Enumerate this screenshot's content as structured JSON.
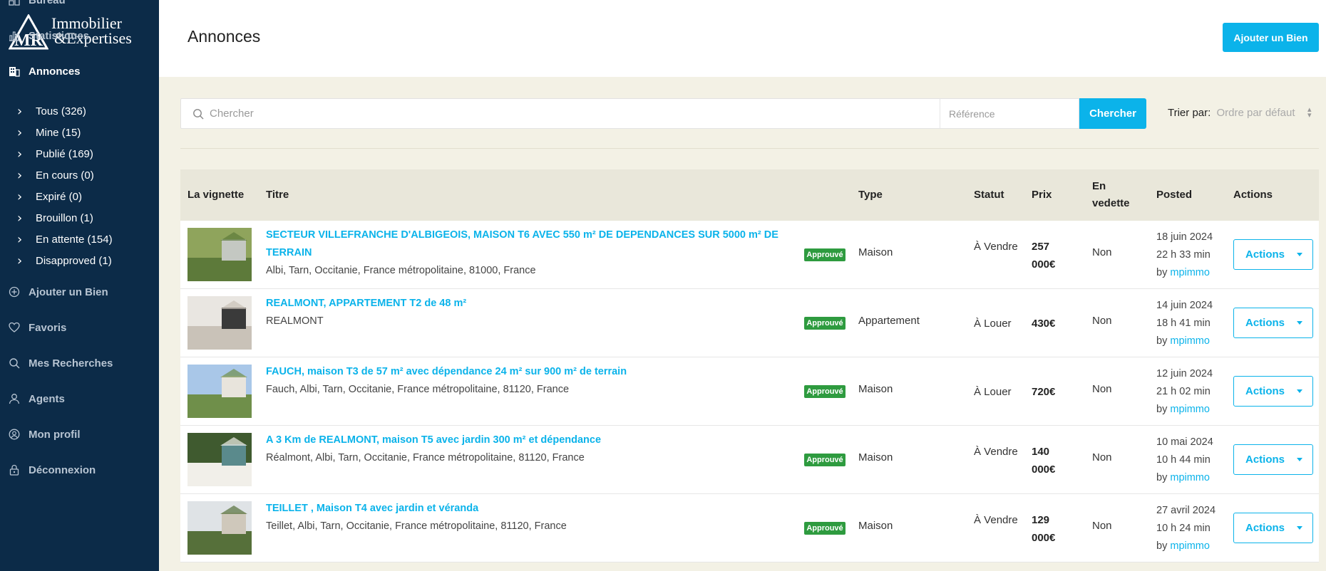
{
  "brand": {
    "logo_monogram": "MR",
    "logo_line1": "Immobilier",
    "logo_line2": "Expertises",
    "sidebar_bg": "#0c2b48",
    "accent": "#0bb3ea"
  },
  "sidebar": {
    "items": [
      {
        "label": "Bureau",
        "icon": "dashboard-icon",
        "active": false
      },
      {
        "label": "Statistiques",
        "icon": "bar-chart-icon",
        "active": false
      },
      {
        "label": "Annonces",
        "icon": "building-icon",
        "active": true
      },
      {
        "label": "Ajouter un Bien",
        "icon": "plus-circle-icon",
        "active": false
      },
      {
        "label": "Favoris",
        "icon": "heart-icon",
        "active": false
      },
      {
        "label": "Mes Recherches",
        "icon": "search-icon",
        "active": false
      },
      {
        "label": "Agents",
        "icon": "user-icon",
        "active": false
      },
      {
        "label": "Mon profil",
        "icon": "user-circle-icon",
        "active": false
      },
      {
        "label": "Déconnexion",
        "icon": "lock-icon",
        "active": false
      }
    ],
    "sub_items": [
      {
        "label": "Tous (326)"
      },
      {
        "label": "Mine (15)"
      },
      {
        "label": "Publié (169)"
      },
      {
        "label": "En cours (0)"
      },
      {
        "label": "Expiré (0)"
      },
      {
        "label": "Brouillon (1)"
      },
      {
        "label": "En attente (154)"
      },
      {
        "label": "Disapproved (1)"
      }
    ]
  },
  "header": {
    "title": "Annonces",
    "add_button": "Ajouter un Bien"
  },
  "search": {
    "placeholder": "Chercher",
    "reference_placeholder": "Référence",
    "button": "Chercher",
    "sort_label": "Trier par:",
    "sort_value": "Ordre par défaut"
  },
  "table": {
    "columns": {
      "thumbnail": "La vignette",
      "title": "Titre",
      "type": "Type",
      "status": "Statut",
      "price": "Prix",
      "featured_l1": "En",
      "featured_l2": "vedette",
      "posted": "Posted",
      "actions": "Actions"
    },
    "rows": [
      {
        "title": "SECTEUR VILLEFRANCHE D'ALBIGEOIS, MAISON T6 AVEC 550 m² DE DEPENDANCES SUR 5000 m² DE TERRAIN",
        "address": "Albi, Tarn, Occitanie, France métropolitaine, 81000, France",
        "badge": "Approuvé",
        "type": "Maison",
        "status": "À Vendre",
        "price": "257 000€",
        "featured": "Non",
        "date": "18 juin 2024",
        "time": "22 h 33 min",
        "by": "by",
        "author": "mpimmo",
        "actions": "Actions",
        "thumb_colors": [
          "#8fa45c",
          "#5d7a3a",
          "#c4c8c2"
        ]
      },
      {
        "title": "REALMONT, APPARTEMENT T2 de 48 m²",
        "address": "REALMONT",
        "badge": "Approuvé",
        "type": "Appartement",
        "status": "À Louer",
        "price": "430€",
        "featured": "Non",
        "date": "14 juin 2024",
        "time": "18 h 41 min",
        "by": "by",
        "author": "mpimmo",
        "actions": "Actions",
        "thumb_colors": [
          "#e9e6e1",
          "#c9c2b8",
          "#3a3a3a"
        ]
      },
      {
        "title": "FAUCH, maison T3 de 57 m² avec dépendance 24 m² sur 900 m² de terrain",
        "address": "Fauch, Albi, Tarn, Occitanie, France métropolitaine, 81120, France",
        "badge": "Approuvé",
        "type": "Maison",
        "status": "À Louer",
        "price": "720€",
        "featured": "Non",
        "date": "12 juin 2024",
        "time": "21 h 02 min",
        "by": "by",
        "author": "mpimmo",
        "actions": "Actions",
        "thumb_colors": [
          "#a9c7e8",
          "#6f8f4a",
          "#e8e4dc"
        ]
      },
      {
        "title": "A 3 Km de REALMONT, maison T5 avec jardin 300 m² et dépendance",
        "address": "Réalmont, Albi, Tarn, Occitanie, France métropolitaine, 81120, France",
        "badge": "Approuvé",
        "type": "Maison",
        "status": "À Vendre",
        "price": "140 000€",
        "featured": "Non",
        "date": "10 mai 2024",
        "time": "10 h 44 min",
        "by": "by",
        "author": "mpimmo",
        "actions": "Actions",
        "thumb_colors": [
          "#3f5a2f",
          "#f1efe9",
          "#5a8a8c"
        ]
      },
      {
        "title": "TEILLET , Maison T4 avec jardin et véranda",
        "address": "Teillet, Albi, Tarn, Occitanie, France métropolitaine, 81120, France",
        "badge": "Approuvé",
        "type": "Maison",
        "status": "À Vendre",
        "price": "129 000€",
        "featured": "Non",
        "date": "27 avril 2024",
        "time": "10 h 24 min",
        "by": "by",
        "author": "mpimmo",
        "actions": "Actions",
        "thumb_colors": [
          "#dfe3e6",
          "#56703a",
          "#cfc8bb"
        ]
      }
    ]
  }
}
